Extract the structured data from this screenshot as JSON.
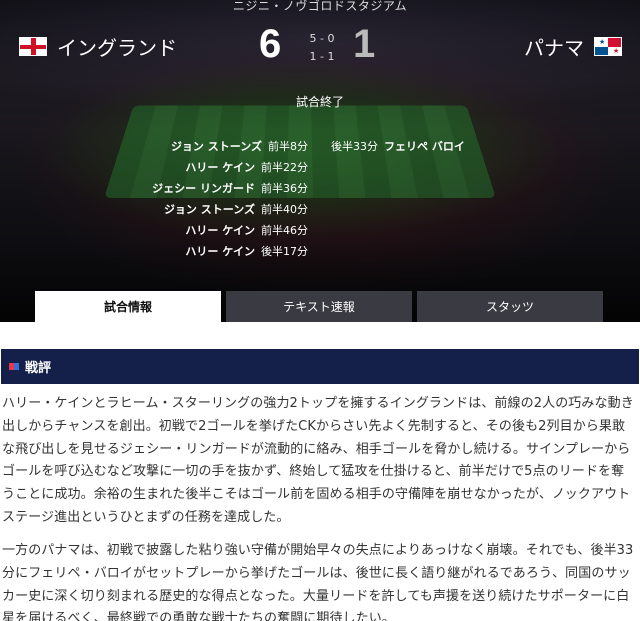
{
  "match": {
    "venue": "ニジニ・ノヴゴロドスタジアム",
    "status": "試合終了",
    "home": {
      "name": "イングランド",
      "score": "6",
      "flag": "england-flag-icon"
    },
    "away": {
      "name": "パナマ",
      "score": "1",
      "flag": "panama-flag-icon"
    },
    "halves": {
      "first": "5 - 0",
      "second": "1 - 1"
    }
  },
  "goals": {
    "home": [
      {
        "player": "ジョン ストーンズ",
        "time": "前半8分"
      },
      {
        "player": "ハリー ケイン",
        "time": "前半22分"
      },
      {
        "player": "ジェシー リンガード",
        "time": "前半36分"
      },
      {
        "player": "ジョン ストーンズ",
        "time": "前半40分"
      },
      {
        "player": "ハリー ケイン",
        "time": "前半46分"
      },
      {
        "player": "ハリー ケイン",
        "time": "後半17分"
      }
    ],
    "away": [
      {
        "time": "後半33分",
        "player": "フェリペ バロイ"
      }
    ]
  },
  "tabs": [
    {
      "label": "試合情報",
      "active": true
    },
    {
      "label": "テキスト速報",
      "active": false
    },
    {
      "label": "スタッツ",
      "active": false
    }
  ],
  "commentary": {
    "title": "戦評",
    "paragraph1": "ハリー・ケインとラヒーム・スターリングの強力2トップを擁するイングランドは、前線の2人の巧みな動き出しからチャンスを創出。初戦で2ゴールを挙げたCKからさい先よく先制すると、その後も2列目から果敢な飛び出しを見せるジェシー・リンガードが流動的に絡み、相手ゴールを脅かし続ける。サインプレーからゴールを呼び込むなど攻撃に一切の手を抜かず、終始して猛攻を仕掛けると、前半だけで5点のリードを奪うことに成功。余裕の生まれた後半こそはゴール前を固める相手の守備陣を崩せなかったが、ノックアウトステージ進出というひとまずの任務を達成した。",
    "paragraph2": "一方のパナマは、初戦で披露した粘り強い守備が開始早々の失点によりあっけなく崩壊。それでも、後半33分にフェリペ・バロイがセットプレーから挙げたゴールは、後世に長く語り継がれるであろう、同国のサッカー史に深く切り刻まれる歴史的な得点となった。大量リードを許しても声援を送り続けたサポーターに白星を届けるべく、最終戦での勇敢な戦士たちの奮闘に期待したい。"
  },
  "colors": {
    "header_bar": "#14204a",
    "tab_inactive": "#3a3a42",
    "accent_red": "#e8384f",
    "accent_blue": "#3b6fd6"
  }
}
